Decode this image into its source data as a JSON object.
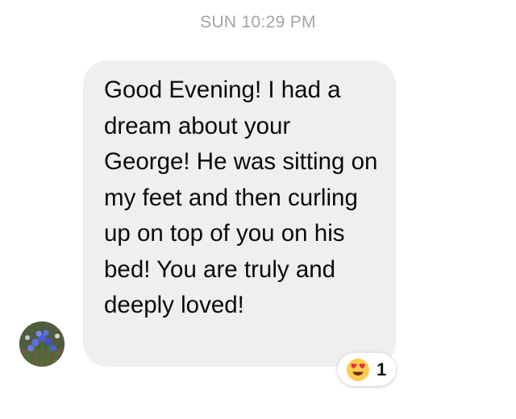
{
  "header": {
    "timestamp": "SUN 10:29 PM"
  },
  "message": {
    "sender_avatar_icon": "flower-avatar-icon",
    "text": "Good Evening! I had a dream about your George! He was sitting on my feet and then curling up on top of you on his bed! You are truly and deeply loved!",
    "bubble_color": "#efeff0",
    "reaction": {
      "emoji_icon": "heart-eyes-emoji-icon",
      "count": "1"
    }
  }
}
